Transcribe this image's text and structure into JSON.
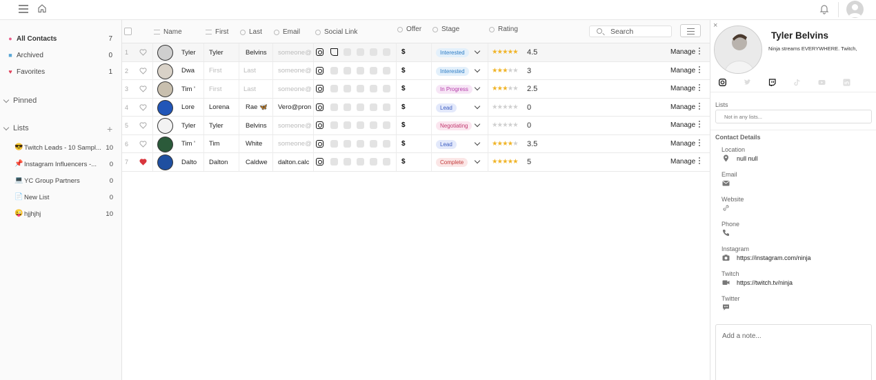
{
  "sidebar": {
    "items": [
      {
        "label": "All Contacts",
        "count": "7",
        "color": "#e85d8a"
      },
      {
        "label": "Archived",
        "count": "0",
        "color": "#5aa7d6"
      },
      {
        "label": "Favorites",
        "count": "1",
        "color": "#e0405a"
      }
    ],
    "pinned_label": "Pinned",
    "lists_label": "Lists",
    "add_symbol": "+",
    "lists": [
      {
        "emoji": "😎",
        "label": "Twitch Leads - 10 Sampl...",
        "count": "10"
      },
      {
        "emoji": "📌",
        "label": "Instagram Influencers -...",
        "count": "0"
      },
      {
        "emoji": "💻",
        "label": "YC Group Partners",
        "count": "0"
      },
      {
        "emoji": "📄",
        "label": "New List",
        "count": "0"
      },
      {
        "emoji": "😜",
        "label": "hjjhjhj",
        "count": "10"
      }
    ]
  },
  "table": {
    "headers": {
      "name": "Name",
      "first": "First",
      "last": "Last",
      "email": "Email",
      "social": "Social Link",
      "offer": "Offer",
      "stage": "Stage",
      "rating": "Rating"
    },
    "search_placeholder": "Search",
    "manage_label": "Manage",
    "rows": [
      {
        "num": "1",
        "name": "Tyler",
        "first": "Tyler",
        "last": "Belvins",
        "email": "someone@",
        "offer": "$",
        "stage": "Interested",
        "stars": 4.5,
        "rating": "4.5",
        "fav": false,
        "twitch": true,
        "first_ph": false,
        "last_ph": false,
        "email_ph": true
      },
      {
        "num": "2",
        "name": "Dwa",
        "first": "First",
        "last": "Last",
        "email": "someone@",
        "offer": "$",
        "stage": "Interested",
        "stars": 3,
        "rating": "3",
        "fav": false,
        "twitch": false,
        "first_ph": true,
        "last_ph": true,
        "email_ph": true
      },
      {
        "num": "3",
        "name": "Tim '",
        "first": "First",
        "last": "Last",
        "email": "someone@",
        "offer": "$",
        "stage": "In Progress",
        "stars": 2.5,
        "rating": "2.5",
        "fav": false,
        "twitch": false,
        "first_ph": true,
        "last_ph": true,
        "email_ph": true
      },
      {
        "num": "4",
        "name": "Lore",
        "first": "Lorena",
        "last": "Rae 🦋",
        "email": "Vero@pron",
        "offer": "$",
        "stage": "Lead",
        "stars": 0,
        "rating": "0",
        "fav": false,
        "twitch": false,
        "first_ph": false,
        "last_ph": false,
        "email_ph": false
      },
      {
        "num": "5",
        "name": "Tyler",
        "first": "Tyler",
        "last": "Belvins",
        "email": "someone@",
        "offer": "$",
        "stage": "Negotiating",
        "stars": 0,
        "rating": "0",
        "fav": false,
        "twitch": false,
        "first_ph": false,
        "last_ph": false,
        "email_ph": true
      },
      {
        "num": "6",
        "name": "Tim '",
        "first": "Tim",
        "last": "White",
        "email": "someone@",
        "offer": "$",
        "stage": "Lead",
        "stars": 3.5,
        "rating": "3.5",
        "fav": false,
        "twitch": false,
        "first_ph": false,
        "last_ph": false,
        "email_ph": true
      },
      {
        "num": "7",
        "name": "Dalto",
        "first": "Dalton",
        "last": "Caldwe",
        "email": "dalton.calc",
        "offer": "$",
        "stage": "Complete",
        "stars": 5,
        "rating": "5",
        "fav": true,
        "twitch": false,
        "first_ph": false,
        "last_ph": false,
        "email_ph": false
      }
    ]
  },
  "stage_colors": {
    "Interested": {
      "bg": "#e3f0fb",
      "fg": "#2b7bc4"
    },
    "In Progress": {
      "bg": "#f7e6f6",
      "fg": "#b43aa9"
    },
    "Lead": {
      "bg": "#e3e9fb",
      "fg": "#3b5bc0"
    },
    "Negotiating": {
      "bg": "#fbe6ef",
      "fg": "#c2386f"
    },
    "Complete": {
      "bg": "#fbe6e6",
      "fg": "#c23a3a"
    }
  },
  "panel": {
    "close": "×",
    "name": "Tyler Belvins",
    "bio": "Ninja streams EVERYWHERE. Twitch,",
    "lists_label": "Lists",
    "lists_value": "Not in any lists...",
    "contact_details_label": "Contact Details",
    "fields": [
      {
        "label": "Location",
        "value": "null null",
        "icon": "location-pin-icon"
      },
      {
        "label": "Email",
        "value": "",
        "icon": "envelope-icon"
      },
      {
        "label": "Website",
        "value": "",
        "icon": "link-icon"
      },
      {
        "label": "Phone",
        "value": "",
        "icon": "phone-icon"
      },
      {
        "label": "Instagram",
        "value": "https://instagram.com/ninja",
        "icon": "camera-icon"
      },
      {
        "label": "Twitch",
        "value": "https://twitch.tv/ninja",
        "icon": "video-icon"
      },
      {
        "label": "Twitter",
        "value": "",
        "icon": "chat-bubble-icon"
      }
    ],
    "note_placeholder": "Add a note..."
  }
}
